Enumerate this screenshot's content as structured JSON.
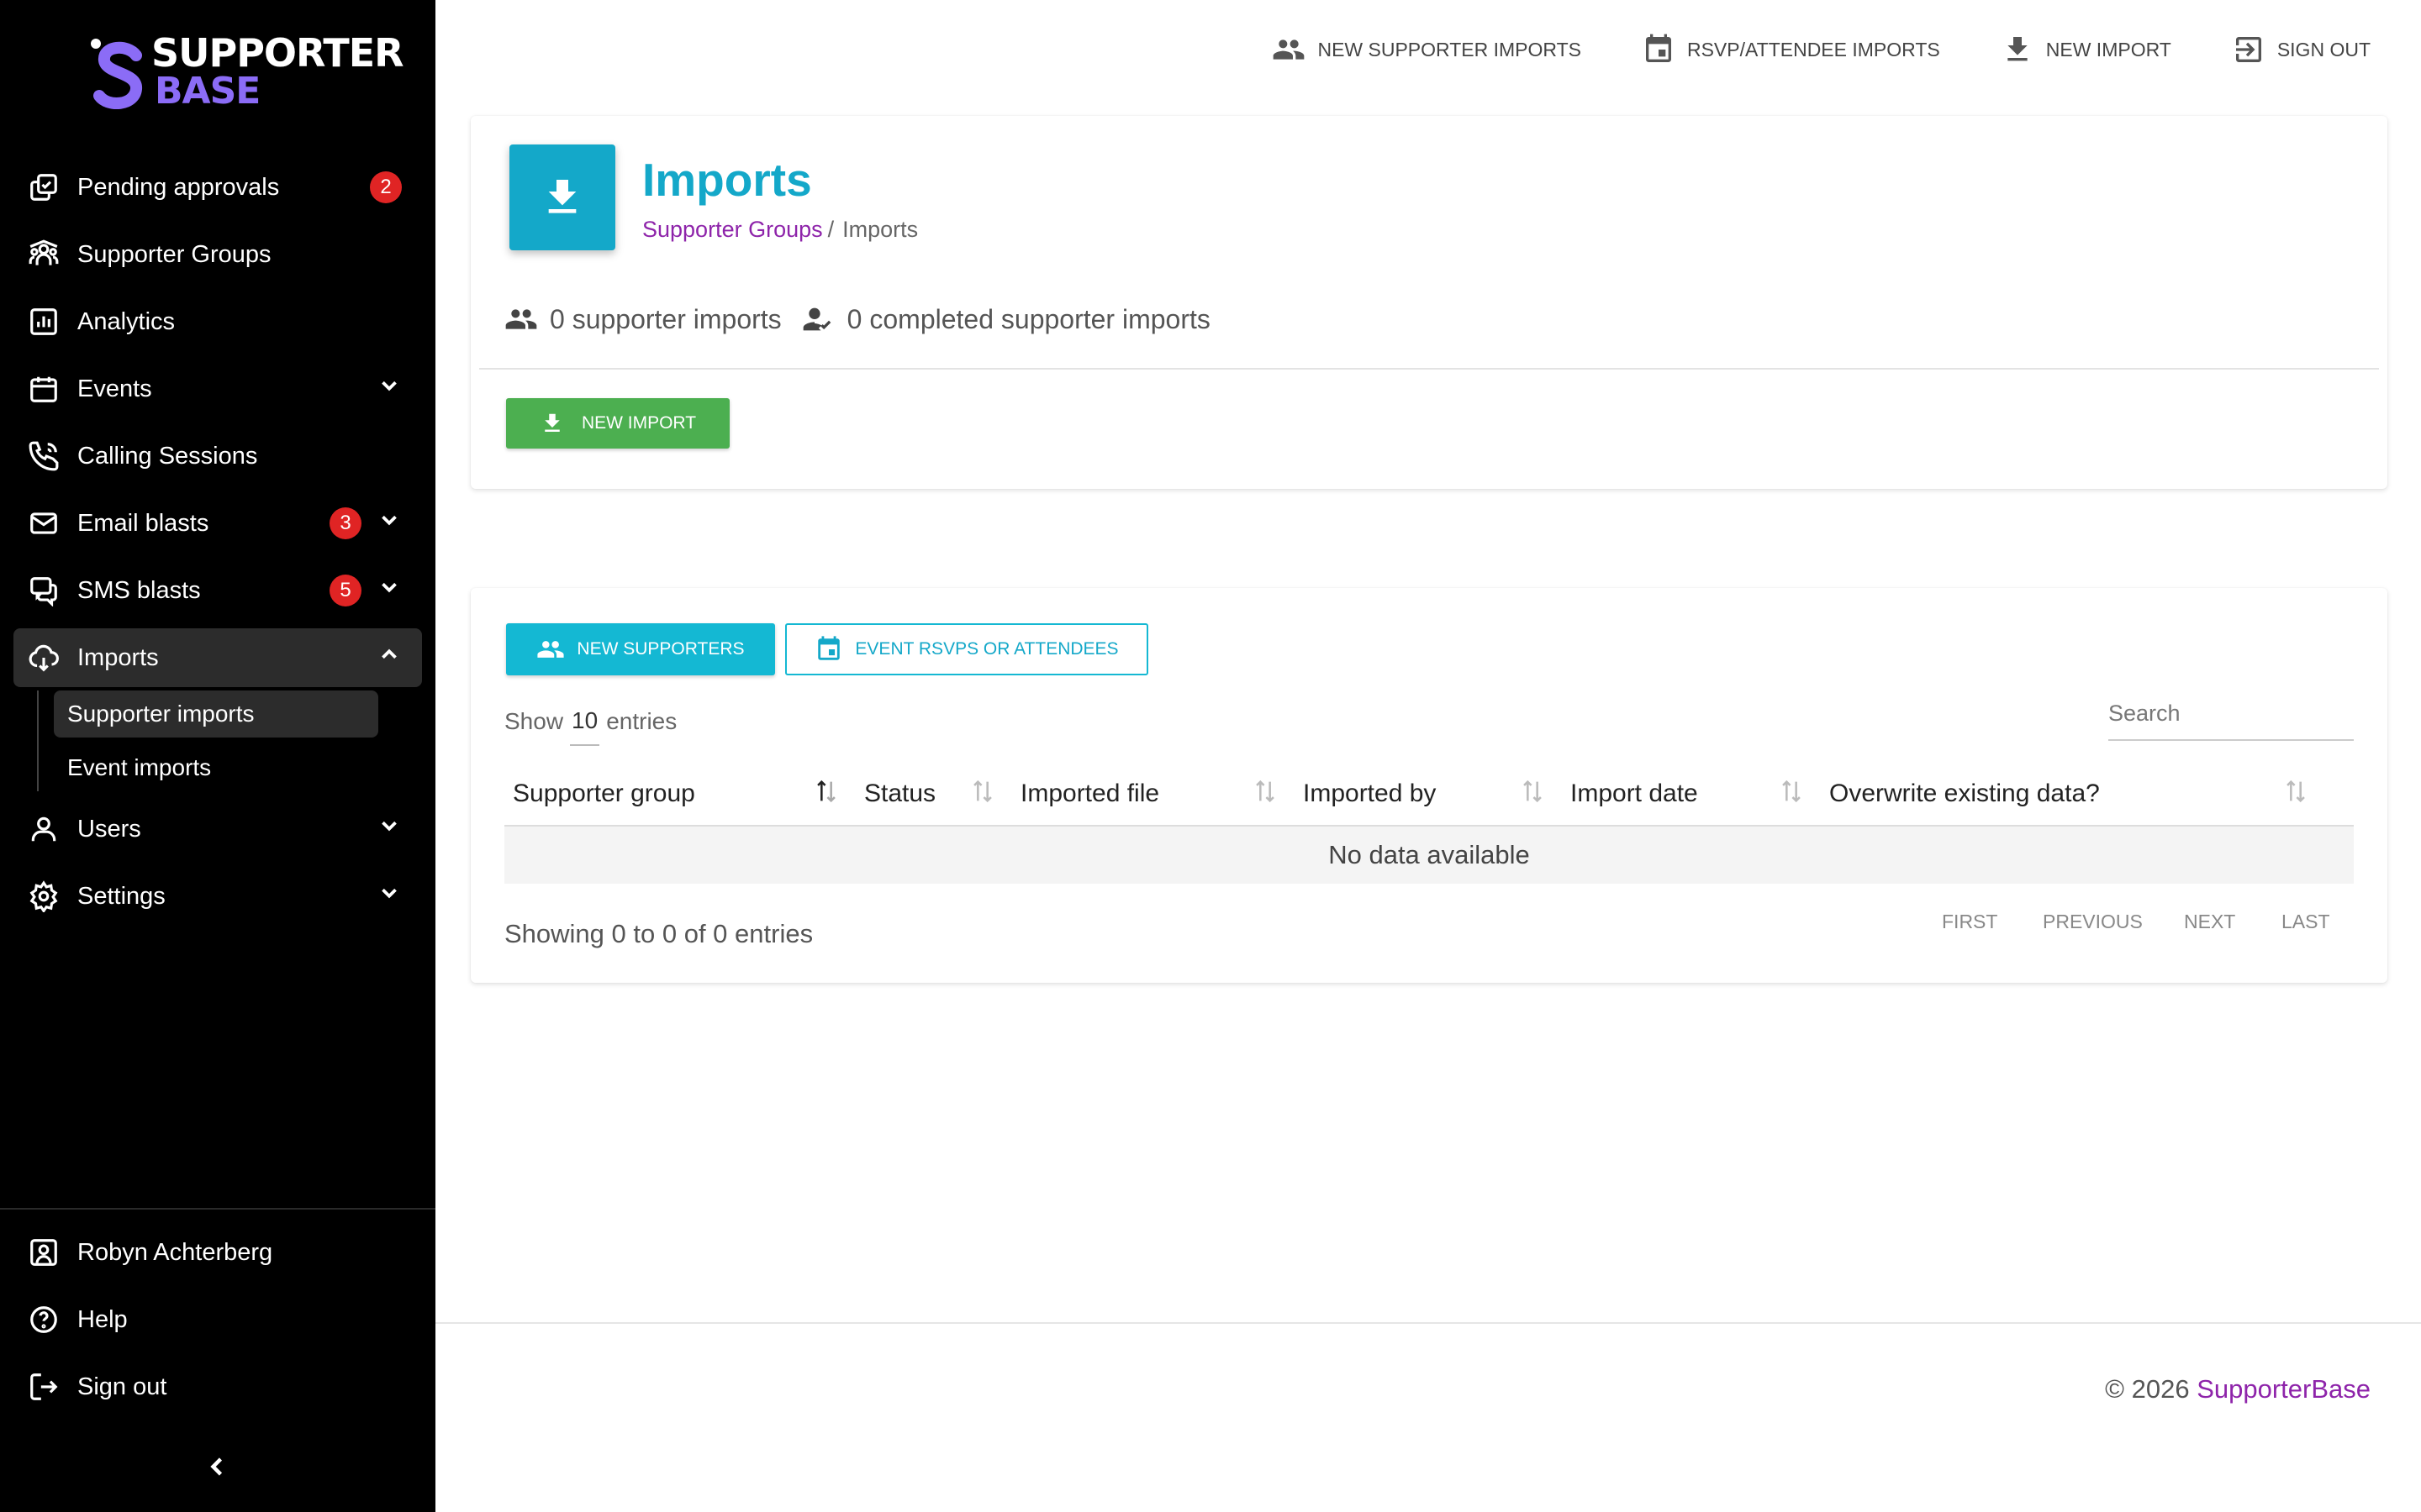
{
  "brand": {
    "line1": "SUPPORTER",
    "line2": "BASE"
  },
  "sidebar": {
    "items": [
      {
        "label": "Pending approvals",
        "badge": "2"
      },
      {
        "label": "Supporter Groups"
      },
      {
        "label": "Analytics"
      },
      {
        "label": "Events"
      },
      {
        "label": "Calling Sessions"
      },
      {
        "label": "Email blasts",
        "badge": "3"
      },
      {
        "label": "SMS blasts",
        "badge": "5"
      },
      {
        "label": "Imports"
      },
      {
        "label": "Users"
      },
      {
        "label": "Settings"
      }
    ],
    "sub_items": [
      {
        "label": "Supporter imports"
      },
      {
        "label": "Event imports"
      }
    ],
    "bottom": [
      {
        "label": "Robyn Achterberg"
      },
      {
        "label": "Help"
      },
      {
        "label": "Sign out"
      }
    ]
  },
  "topbar": {
    "links": [
      {
        "label": "NEW SUPPORTER IMPORTS"
      },
      {
        "label": "RSVP/ATTENDEE IMPORTS"
      },
      {
        "label": "NEW IMPORT"
      },
      {
        "label": "SIGN OUT"
      }
    ]
  },
  "header": {
    "title": "Imports",
    "breadcrumb_link": "Supporter Groups",
    "breadcrumb_sep": "/",
    "breadcrumb_current": "Imports"
  },
  "stats": {
    "supporter_imports": "0 supporter imports",
    "completed_imports": "0 completed supporter imports"
  },
  "actions": {
    "new_import": "NEW IMPORT"
  },
  "tabs": {
    "new_supporters": "NEW SUPPORTERS",
    "event_rsvps": "EVENT RSVPS OR ATTENDEES"
  },
  "table": {
    "show_label": "Show",
    "page_size": "10",
    "entries_label": "entries",
    "search_placeholder": "Search",
    "columns": [
      "Supporter group",
      "Status",
      "Imported file",
      "Imported by",
      "Import date",
      "Overwrite existing data?"
    ],
    "empty_text": "No data available",
    "showing_text": "Showing 0 to 0 of 0 entries",
    "pager": [
      "FIRST",
      "PREVIOUS",
      "NEXT",
      "LAST"
    ]
  },
  "footer": {
    "copyright": "© 2026",
    "brand": "SupporterBase"
  },
  "colors": {
    "accent": "#14a8c9",
    "link": "#8e24aa",
    "success": "#4caf50",
    "badge": "#e02424",
    "sidebar_bg": "#000000"
  }
}
